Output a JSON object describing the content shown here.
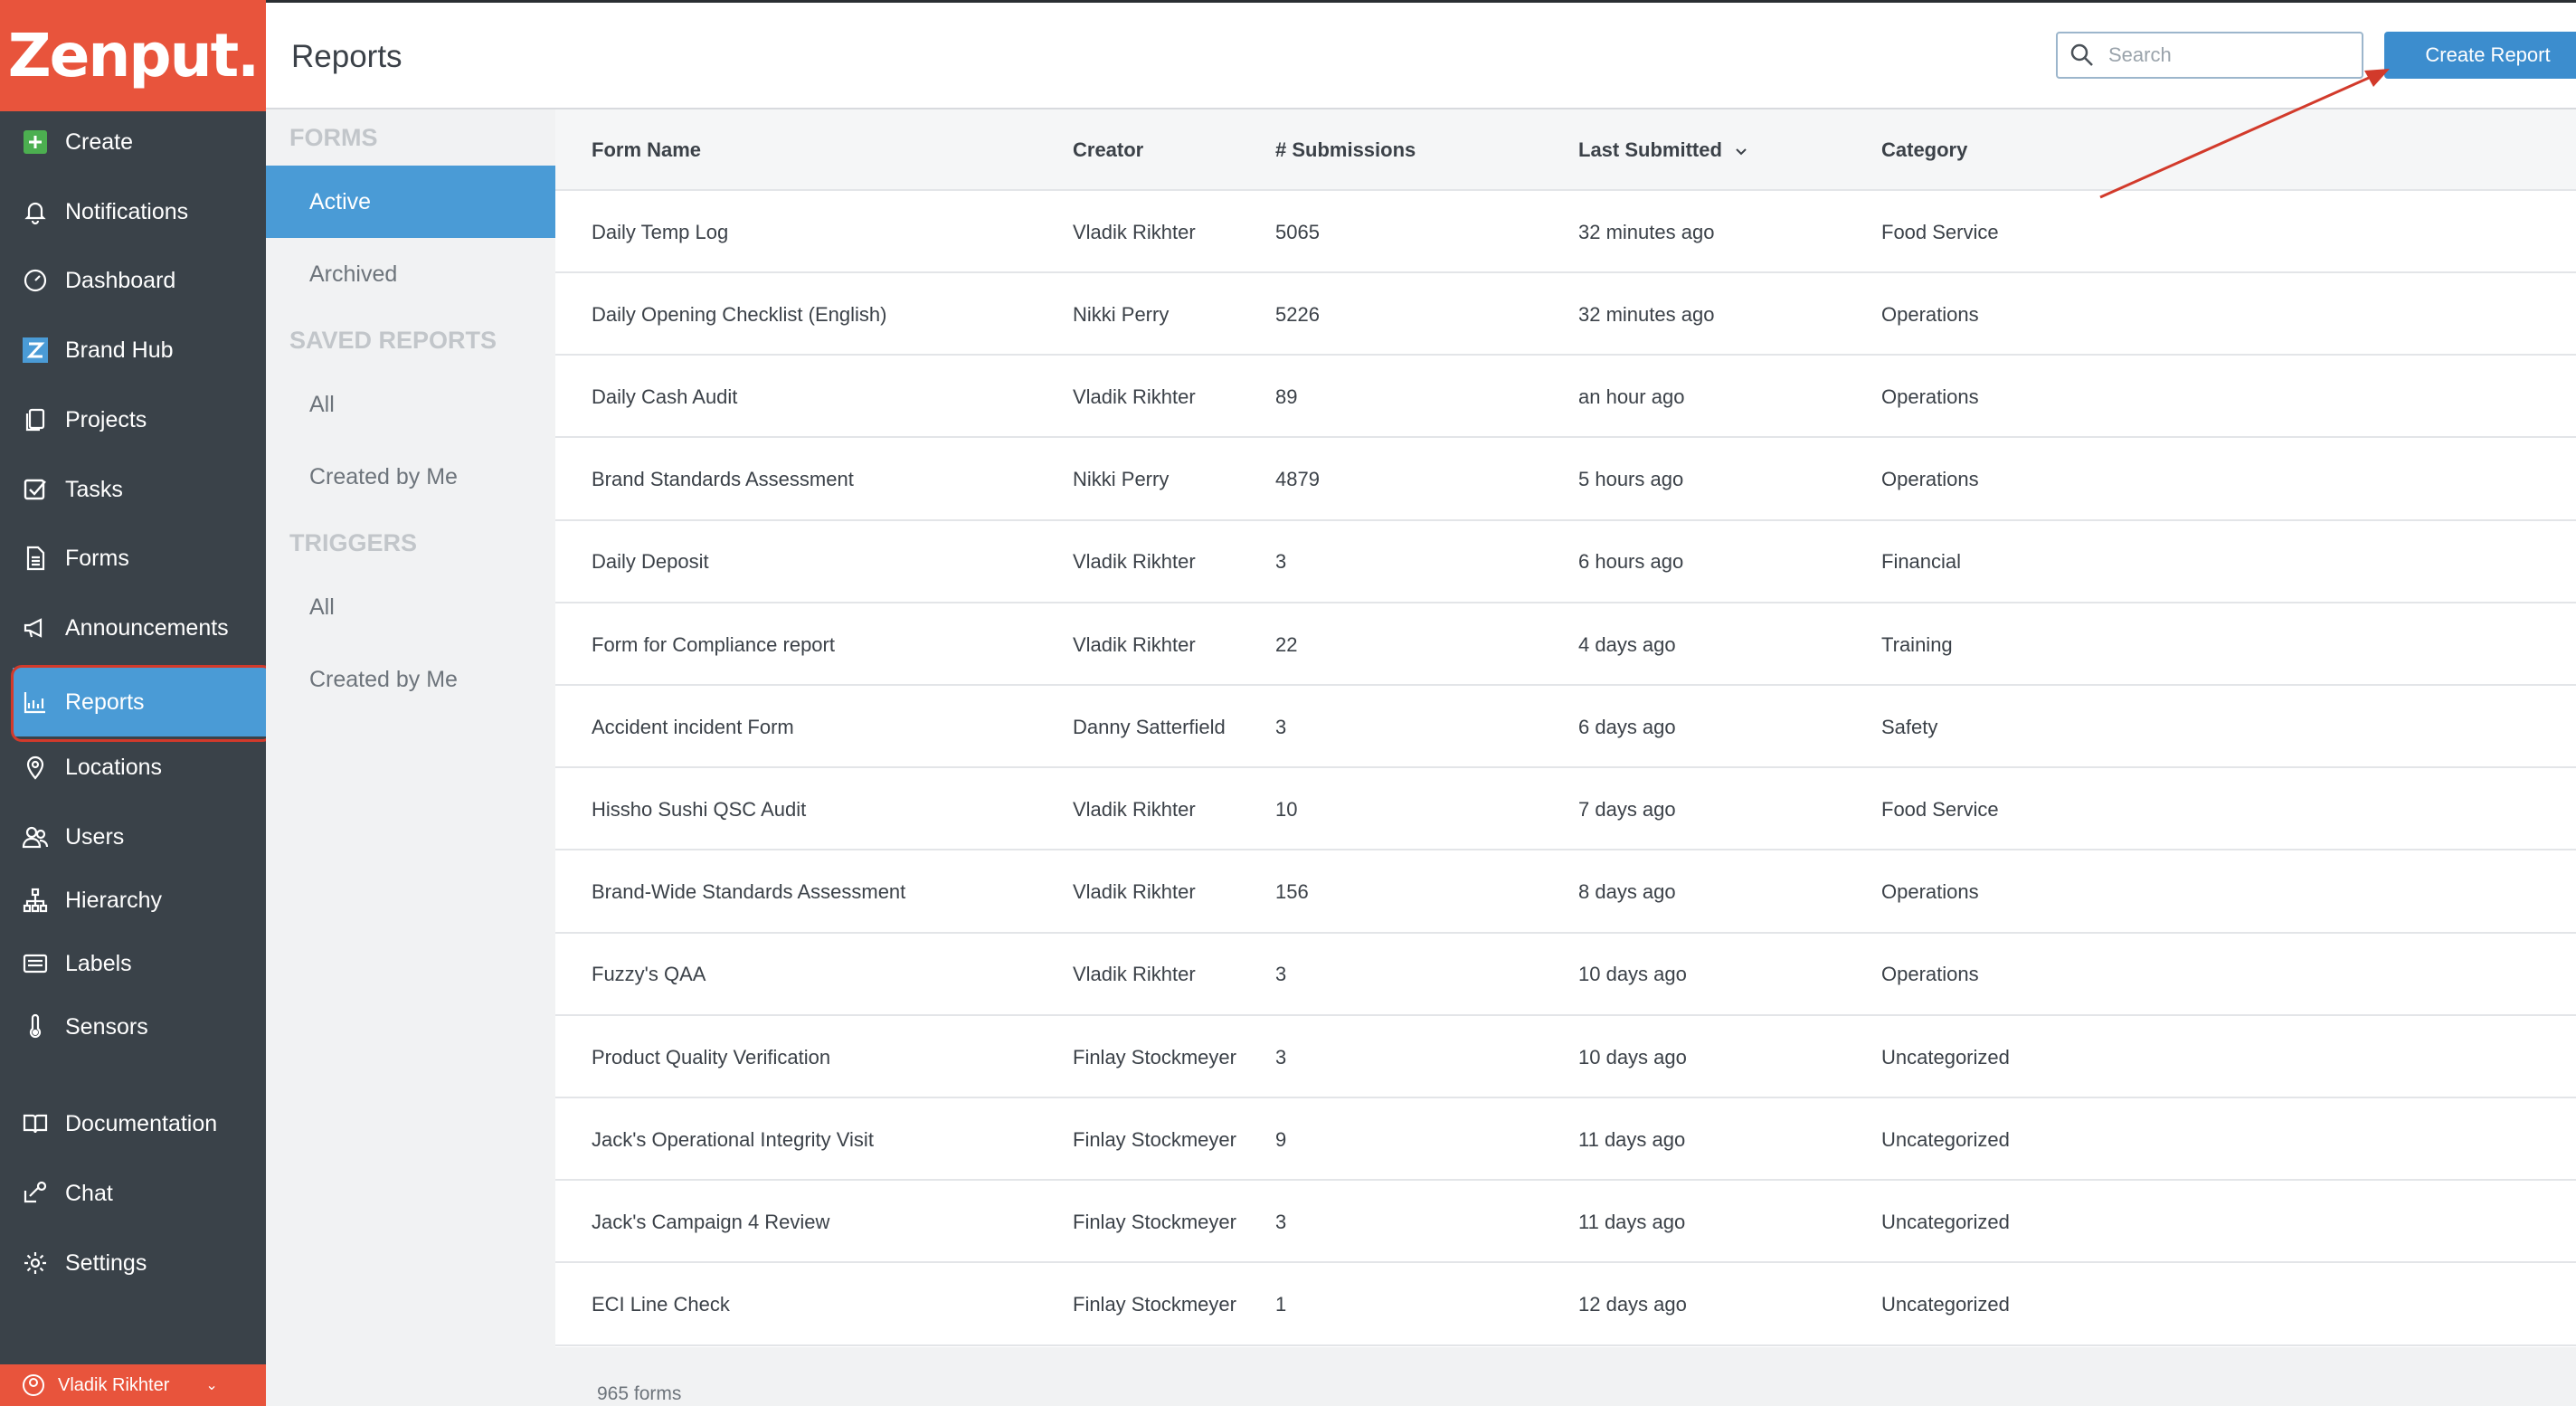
{
  "app": {
    "logo_text": "Zenput."
  },
  "nav": {
    "items": [
      {
        "label": "Create",
        "icon": "plus-square-icon"
      },
      {
        "label": "Notifications",
        "icon": "bell-icon"
      },
      {
        "label": "Dashboard",
        "icon": "gauge-icon"
      },
      {
        "label": "Brand Hub",
        "icon": "brand-z-icon"
      },
      {
        "label": "Projects",
        "icon": "projects-icon"
      },
      {
        "label": "Tasks",
        "icon": "checkbox-icon"
      },
      {
        "label": "Forms",
        "icon": "document-icon"
      },
      {
        "label": "Announcements",
        "icon": "megaphone-icon"
      },
      {
        "label": "Reports",
        "icon": "chart-icon"
      },
      {
        "label": "Locations",
        "icon": "pin-icon"
      },
      {
        "label": "Users",
        "icon": "users-icon"
      },
      {
        "label": "Hierarchy",
        "icon": "hierarchy-icon"
      },
      {
        "label": "Labels",
        "icon": "labels-icon"
      },
      {
        "label": "Sensors",
        "icon": "thermometer-icon"
      },
      {
        "label": "Documentation",
        "icon": "book-icon"
      },
      {
        "label": "Chat",
        "icon": "chat-icon"
      },
      {
        "label": "Settings",
        "icon": "gear-icon"
      }
    ],
    "user_label": "Vladik Rikhter"
  },
  "header": {
    "title": "Reports",
    "search_placeholder": "Search",
    "create_button": "Create Report"
  },
  "subnav": {
    "forms_heading": "FORMS",
    "forms_active": "Active",
    "forms_archived": "Archived",
    "saved_heading": "SAVED REPORTS",
    "saved_all": "All",
    "saved_created_by_me": "Created by Me",
    "triggers_heading": "TRIGGERS",
    "triggers_all": "All",
    "triggers_created_by_me": "Created by Me"
  },
  "table": {
    "columns": [
      "Form Name",
      "Creator",
      "# Submissions",
      "Last Submitted",
      "Category"
    ],
    "rows": [
      [
        "Daily Temp Log",
        "Vladik Rikhter",
        "5065",
        "32 minutes ago",
        "Food Service"
      ],
      [
        "Daily Opening Checklist (English)",
        "Nikki Perry",
        "5226",
        "32 minutes ago",
        "Operations"
      ],
      [
        "Daily Cash Audit",
        "Vladik Rikhter",
        "89",
        "an hour ago",
        "Operations"
      ],
      [
        "Brand Standards Assessment",
        "Nikki Perry",
        "4879",
        "5 hours ago",
        "Operations"
      ],
      [
        "Daily Deposit",
        "Vladik Rikhter",
        "3",
        "6 hours ago",
        "Financial"
      ],
      [
        "Form for Compliance report",
        "Vladik Rikhter",
        "22",
        "4 days ago",
        "Training"
      ],
      [
        "Accident incident Form",
        "Danny Satterfield",
        "3",
        "6 days ago",
        "Safety"
      ],
      [
        "Hissho Sushi QSC Audit",
        "Vladik Rikhter",
        "10",
        "7 days ago",
        "Food Service"
      ],
      [
        "Brand-Wide Standards Assessment",
        "Vladik Rikhter",
        "156",
        "8 days ago",
        "Operations"
      ],
      [
        "Fuzzy's QAA",
        "Vladik Rikhter",
        "3",
        "10 days ago",
        "Operations"
      ],
      [
        "Product Quality Verification",
        "Finlay Stockmeyer",
        "3",
        "10 days ago",
        "Uncategorized"
      ],
      [
        "Jack's Operational Integrity Visit",
        "Finlay Stockmeyer",
        "9",
        "11 days ago",
        "Uncategorized"
      ],
      [
        "Jack's Campaign 4 Review",
        "Finlay Stockmeyer",
        "3",
        "11 days ago",
        "Uncategorized"
      ],
      [
        "ECI Line Check",
        "Finlay Stockmeyer",
        "1",
        "12 days ago",
        "Uncategorized"
      ]
    ],
    "footer_count": "965 forms"
  },
  "colors": {
    "nav_bg": "#3a4249",
    "brand": "#e8543c",
    "accent": "#4a9bd6",
    "annotation": "#d23a2b"
  }
}
